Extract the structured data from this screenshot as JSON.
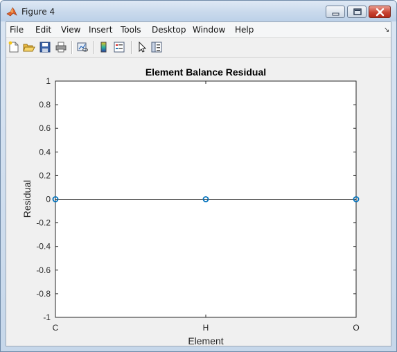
{
  "window": {
    "title": "Figure 4"
  },
  "menu": [
    "File",
    "Edit",
    "View",
    "Insert",
    "Tools",
    "Desktop",
    "Window",
    "Help"
  ],
  "toolbar_icons": [
    "new-figure-icon",
    "open-file-icon",
    "save-icon",
    "print-icon",
    "link-plot-icon",
    "colorbar-icon",
    "legend-icon",
    "pointer-icon",
    "property-editor-icon"
  ],
  "colors": {
    "series": "#0072bd",
    "axes_bg": "#ffffff",
    "figure_bg": "#f0f0f0"
  },
  "chart_data": {
    "type": "line",
    "title": "Element Balance Residual",
    "xlabel": "Element",
    "ylabel": "Residual",
    "categories": [
      "C",
      "H",
      "O"
    ],
    "series": [
      {
        "values": [
          0,
          0,
          0
        ],
        "marker": "circle",
        "color": "#0072bd"
      }
    ],
    "ylim": [
      -1,
      1
    ],
    "yticks": [
      "-1",
      "-0.8",
      "-0.6",
      "-0.4",
      "-0.2",
      "0",
      "0.2",
      "0.4",
      "0.6",
      "0.8",
      "1"
    ],
    "grid": false
  }
}
